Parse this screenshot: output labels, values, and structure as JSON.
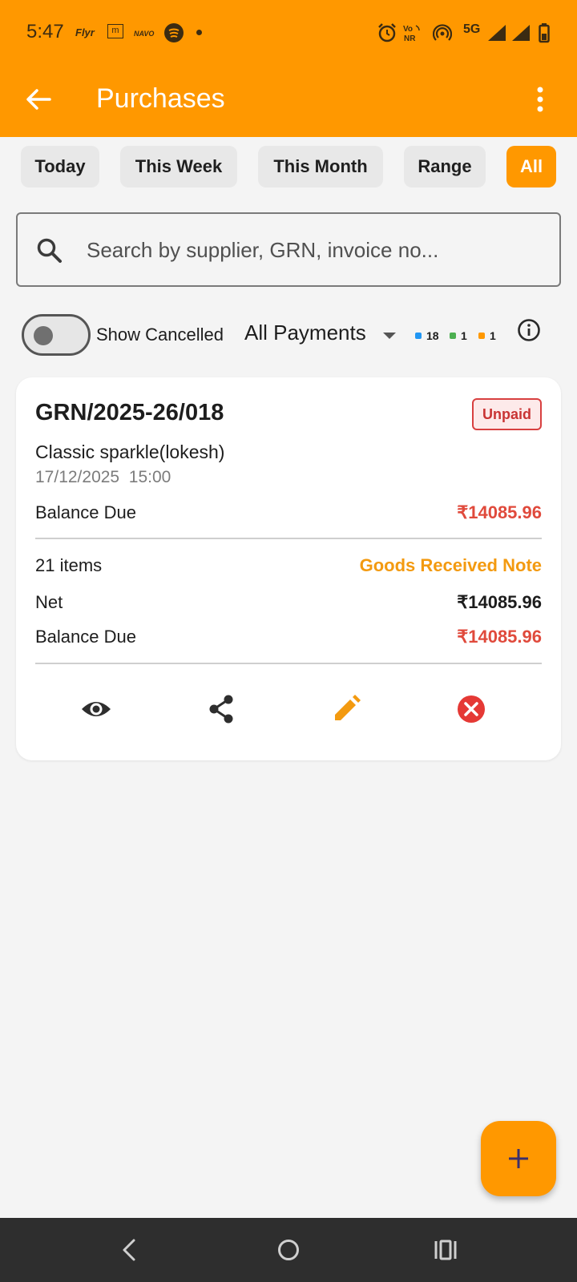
{
  "status_bar": {
    "time": "5:47",
    "apps": [
      "Flyr",
      "m",
      "NAVO"
    ],
    "network": "5G",
    "icons": [
      "alarm-icon",
      "vonr-icon",
      "hotspot-icon",
      "5g-icon",
      "signal-icon",
      "signal-icon",
      "battery-icon"
    ]
  },
  "header": {
    "title": "Purchases",
    "back_icon": "arrow-left-icon",
    "menu_icon": "more-vert-icon"
  },
  "filters": {
    "options": [
      "Today",
      "This Week",
      "This Month",
      "Range",
      "All"
    ],
    "selected": "All"
  },
  "search": {
    "placeholder": "Search by supplier, GRN, invoice no...",
    "value": ""
  },
  "controls": {
    "show_cancelled_label": "Show Cancelled",
    "show_cancelled_on": false,
    "payments_filter": "All Payments",
    "legend": [
      {
        "count": "18",
        "color": "#2196f3"
      },
      {
        "count": "1",
        "color": "#4caf50"
      },
      {
        "count": "1",
        "color": "#ff9800"
      }
    ]
  },
  "purchases": [
    {
      "grn": "GRN/2025-26/018",
      "status": "Unpaid",
      "supplier": "Classic sparkle(lokesh)",
      "date": "17/12/2025",
      "time": "15:00",
      "balance_due_label": "Balance Due",
      "balance_due": "₹14085.96",
      "items": "21 items",
      "doc_type": "Goods Received Note",
      "net_label": "Net",
      "net": "₹14085.96",
      "balance_due_label_2": "Balance Due",
      "balance_due_2": "₹14085.96",
      "actions": [
        "eye-icon",
        "share-icon",
        "edit-icon",
        "cancel-icon"
      ]
    }
  ],
  "fab": {
    "icon": "plus-icon"
  },
  "colors": {
    "accent": "#ff9800",
    "due_red": "#e04a3c",
    "unpaid_red": "#c93434",
    "background": "#f4f4f4"
  }
}
